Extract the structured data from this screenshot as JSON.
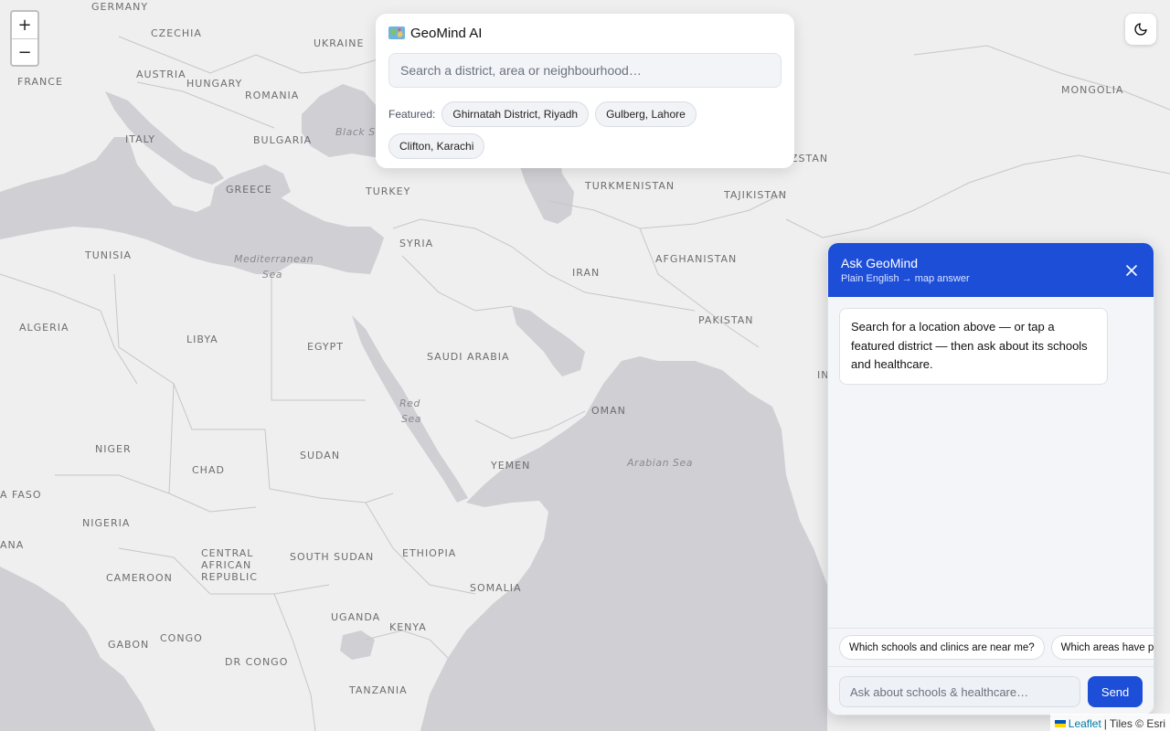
{
  "app": {
    "brand_icon": "world-map-icon",
    "name": "GeoMind AI"
  },
  "search": {
    "placeholder": "Search a district, area or neighbourhood…",
    "featured_label": "Featured:",
    "featured": [
      "Ghirnatah District, Riyadh",
      "Gulberg, Lahore",
      "Clifton, Karachi"
    ]
  },
  "zoom": {
    "in_label": "+",
    "out_label": "−"
  },
  "theme_toggle": {
    "icon": "moon-icon"
  },
  "chat": {
    "title": "Ask GeoMind",
    "subtitle": "Plain English → map answer",
    "close_icon": "close-icon",
    "messages": [
      {
        "role": "assistant",
        "text": "Search for a location above — or tap a featured district — then ask about its schools and healthcare."
      }
    ],
    "suggestions": [
      "Which schools and clinics are near me?",
      "Which areas have p"
    ],
    "input_placeholder": "Ask about schools & healthcare…",
    "send_label": "Send"
  },
  "attribution": {
    "leaflet": "Leaflet",
    "separator": "|",
    "tiles": "Tiles © Esri"
  },
  "map_labels": {
    "germany": "GERMANY",
    "czechia": "CZECHIA",
    "ukraine": "UKRAINE",
    "austria": "AUSTRIA",
    "hungary": "HUNGARY",
    "france": "FRANCE",
    "romania": "ROMANIA",
    "italy": "ITALY",
    "bulgaria": "BULGARIA",
    "black_sea": "Black Sea",
    "greece": "GREECE",
    "turkey": "TURKEY",
    "turkmenistan": "TURKMENISTAN",
    "tajikistan": "TAJIKISTAN",
    "uzbekistan_partial": "ZSTAN",
    "mongolia": "MONGOLIA",
    "tunisia": "TUNISIA",
    "mediterranean": "Mediterranean",
    "mediterranean_2": "Sea",
    "syria": "SYRIA",
    "iran": "IRAN",
    "afghanistan": "AFGHANISTAN",
    "algeria": "ALGERIA",
    "libya": "LIBYA",
    "egypt": "EGYPT",
    "pakistan": "PAKISTAN",
    "saudi_arabia": "SAUDI ARABIA",
    "india_partial": "IN",
    "red_sea": "Red",
    "red_sea_2": "Sea",
    "oman": "OMAN",
    "niger": "NIGER",
    "chad": "CHAD",
    "sudan": "SUDAN",
    "yemen": "YEMEN",
    "arabian_sea": "Arabian Sea",
    "burkina_partial": "A FASO",
    "nigeria": "NIGERIA",
    "car_1": "CENTRAL",
    "car_2": "AFRICAN",
    "car_3": "REPUBLIC",
    "south_sudan": "SOUTH SUDAN",
    "ethiopia": "ETHIOPIA",
    "ghana_partial": "ANA",
    "cameroon": "CAMEROON",
    "somalia": "SOMALIA",
    "uganda": "UGANDA",
    "kenya": "KENYA",
    "gabon": "GABON",
    "congo": "CONGO",
    "dr_congo": "DR CONGO",
    "tanzania": "TANZANIA"
  },
  "colors": {
    "land": "#efefef",
    "water": "#cfcfd4",
    "border": "#c6c6cb",
    "accent": "#1d4ed8"
  }
}
